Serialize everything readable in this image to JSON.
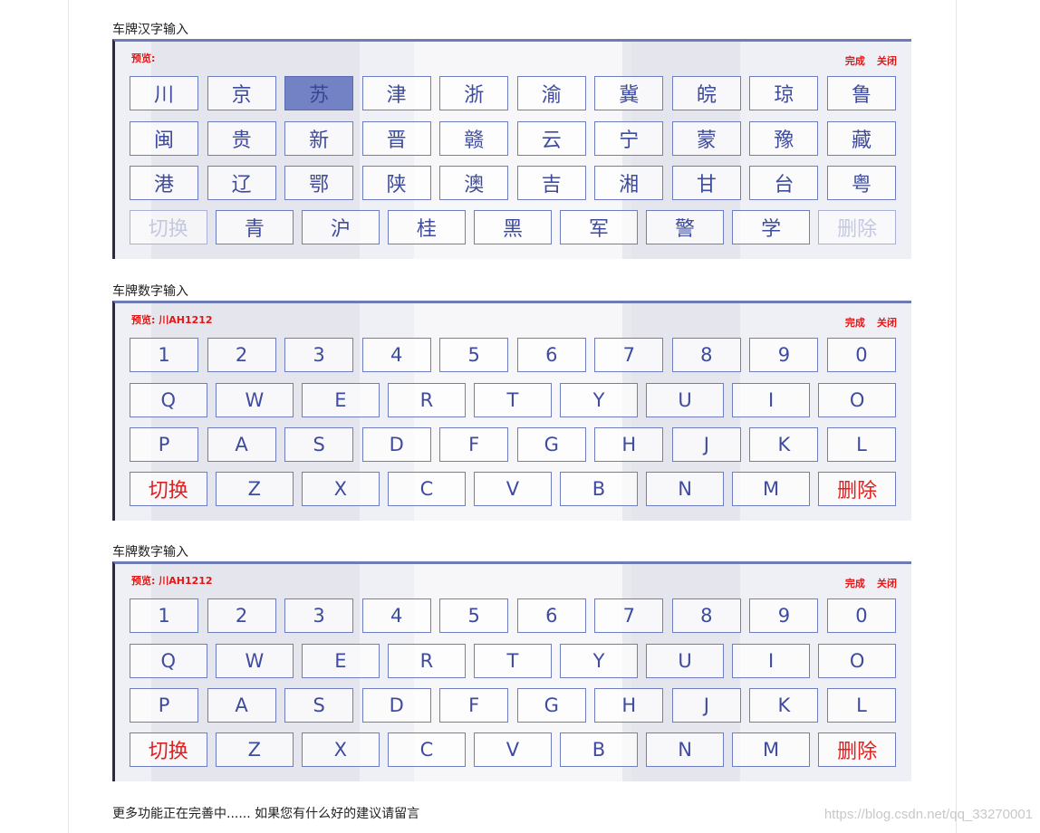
{
  "sections": [
    {
      "caption": "车牌汉字输入",
      "preview": "预览:",
      "actions": {
        "done": "完成",
        "close": "关闭"
      },
      "rows": [
        [
          "川",
          "京",
          "苏",
          "津",
          "浙",
          "渝",
          "冀",
          "皖",
          "琼",
          "鲁"
        ],
        [
          "闽",
          "贵",
          "新",
          "晋",
          "赣",
          "云",
          "宁",
          "蒙",
          "豫",
          "藏"
        ],
        [
          "港",
          "辽",
          "鄂",
          "陕",
          "澳",
          "吉",
          "湘",
          "甘",
          "台",
          "粤"
        ],
        [
          "切换",
          "青",
          "沪",
          "桂",
          "黑",
          "军",
          "警",
          "学",
          "删除"
        ]
      ],
      "active_key": "苏"
    },
    {
      "caption": "车牌数字输入",
      "preview": "预览: 川AH1212",
      "actions": {
        "done": "完成",
        "close": "关闭"
      },
      "rows": [
        [
          "1",
          "2",
          "3",
          "4",
          "5",
          "6",
          "7",
          "8",
          "9",
          "0"
        ],
        [
          "Q",
          "W",
          "E",
          "R",
          "T",
          "Y",
          "U",
          "I",
          "O"
        ],
        [
          "P",
          "A",
          "S",
          "D",
          "F",
          "G",
          "H",
          "J",
          "K",
          "L"
        ],
        [
          "切换",
          "Z",
          "X",
          "C",
          "V",
          "B",
          "N",
          "M",
          "删除"
        ]
      ]
    },
    {
      "caption": "车牌数字输入",
      "preview": "预览: 川AH1212",
      "actions": {
        "done": "完成",
        "close": "关闭"
      },
      "rows": [
        [
          "1",
          "2",
          "3",
          "4",
          "5",
          "6",
          "7",
          "8",
          "9",
          "0"
        ],
        [
          "Q",
          "W",
          "E",
          "R",
          "T",
          "Y",
          "U",
          "I",
          "O"
        ],
        [
          "P",
          "A",
          "S",
          "D",
          "F",
          "G",
          "H",
          "J",
          "K",
          "L"
        ],
        [
          "切换",
          "Z",
          "X",
          "C",
          "V",
          "B",
          "N",
          "M",
          "删除"
        ]
      ]
    }
  ],
  "footer": "更多功能正在完善中...... 如果您有什么好的建议请留言",
  "watermark": "https://blog.csdn.net/qq_33270001",
  "colors": {
    "accent": "#6e7cc0",
    "key_text": "#3e4b9e",
    "red": "#e02020"
  }
}
